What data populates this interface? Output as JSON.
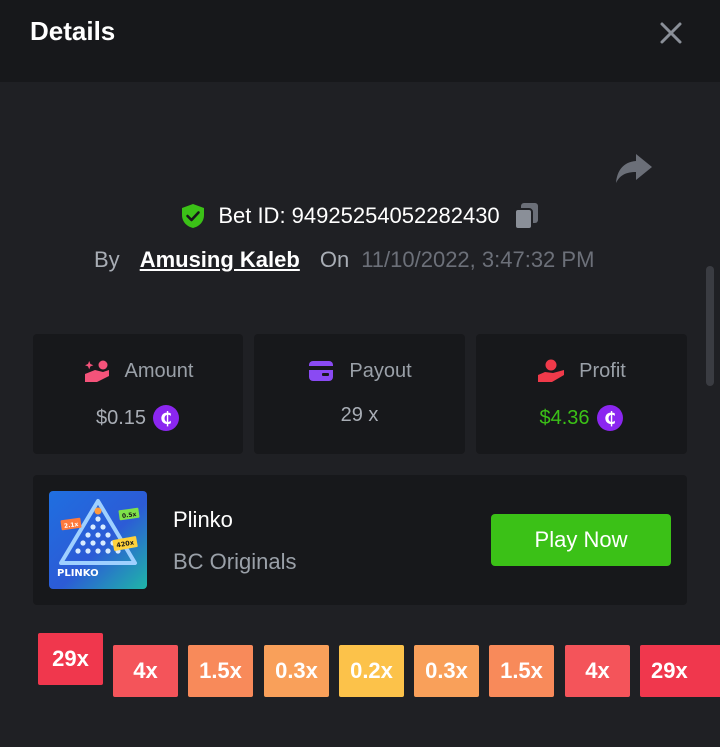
{
  "header": {
    "title": "Details"
  },
  "bet": {
    "id_text": "Bet ID: 94925254052282430",
    "by_label": "By",
    "user": "Amusing Kaleb",
    "on_label": "On",
    "date": "11/10/2022, 3:47:32 PM"
  },
  "stats": [
    {
      "label": "Amount",
      "value": "$0.15",
      "icon": "hand-coins-icon",
      "has_coin": true
    },
    {
      "label": "Payout",
      "value": "29 x",
      "icon": "wallet-icon",
      "has_coin": false
    },
    {
      "label": "Profit",
      "value": "$4.36",
      "icon": "hand-profit-icon",
      "has_coin": true
    }
  ],
  "coin_glyph": "₵",
  "game": {
    "name": "Plinko",
    "provider": "BC Originals",
    "play_label": "Play Now",
    "thumb": {
      "title": "PLINKO",
      "tags": [
        "2.1x",
        "0.5x",
        "420x"
      ]
    }
  },
  "multipliers": [
    "29x",
    "4x",
    "1.5x",
    "0.3x",
    "0.2x",
    "0.3x",
    "1.5x",
    "4x",
    "29x"
  ],
  "multiplier_colors": [
    "#f0374d",
    "#f4545a",
    "#f88a5a",
    "#f9a05a",
    "#fcc24a",
    "#f9a05a",
    "#f88a5a",
    "#f4545a",
    "#f0374d"
  ],
  "colors": {
    "accent_green": "#3bc117",
    "coin_purple": "#8b26f0",
    "profit_green": "#3bc117"
  }
}
